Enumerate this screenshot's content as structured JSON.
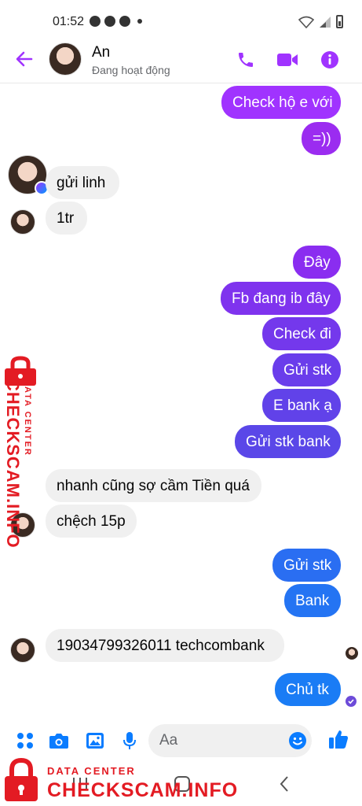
{
  "status_bar": {
    "time": "01:52"
  },
  "header": {
    "contact_name": "An",
    "contact_status": "Đang hoạt động"
  },
  "messages": [
    {
      "side": "out",
      "text": "Check hộ e với"
    },
    {
      "side": "out",
      "text": "=))"
    },
    {
      "side": "in",
      "text": "gửi linh"
    },
    {
      "side": "in",
      "text": "1tr"
    },
    {
      "side": "out",
      "text": "Đây"
    },
    {
      "side": "out",
      "text": "Fb đang ib đây"
    },
    {
      "side": "out",
      "text": "Check đi"
    },
    {
      "side": "out",
      "text": "Gửi stk"
    },
    {
      "side": "out",
      "text": "E bank ạ"
    },
    {
      "side": "out",
      "text": "Gửi stk bank"
    },
    {
      "side": "in",
      "text": "nhanh cũng sợ cầm Tiền quá"
    },
    {
      "side": "in",
      "text": "chệch 15p"
    },
    {
      "side": "out",
      "text": "Gửi stk"
    },
    {
      "side": "out",
      "text": "Bank"
    },
    {
      "side": "in",
      "text": "19034799326011 techcombank"
    },
    {
      "side": "out",
      "text": "Chủ tk"
    }
  ],
  "composer": {
    "placeholder": "Aa"
  },
  "watermark": {
    "small_text": "DATA CENTER",
    "big_text": "CHECKSCAM.INFO"
  },
  "colors": {
    "accent": "#a033ff",
    "bubble_purple": "#9b2cf0",
    "bubble_indigo": "#5a47e8",
    "bubble_blue": "#1a7cf5",
    "incoming_bg": "#f0f0f0",
    "watermark_red": "#e31b23"
  },
  "icons": {
    "header": [
      "back-arrow-icon",
      "phone-icon",
      "video-camera-icon",
      "info-icon"
    ],
    "composer": [
      "apps-grid-icon",
      "camera-icon",
      "image-icon",
      "microphone-icon",
      "emoji-icon",
      "like-icon"
    ],
    "nav": [
      "recent-apps-icon",
      "home-icon",
      "back-icon"
    ]
  }
}
